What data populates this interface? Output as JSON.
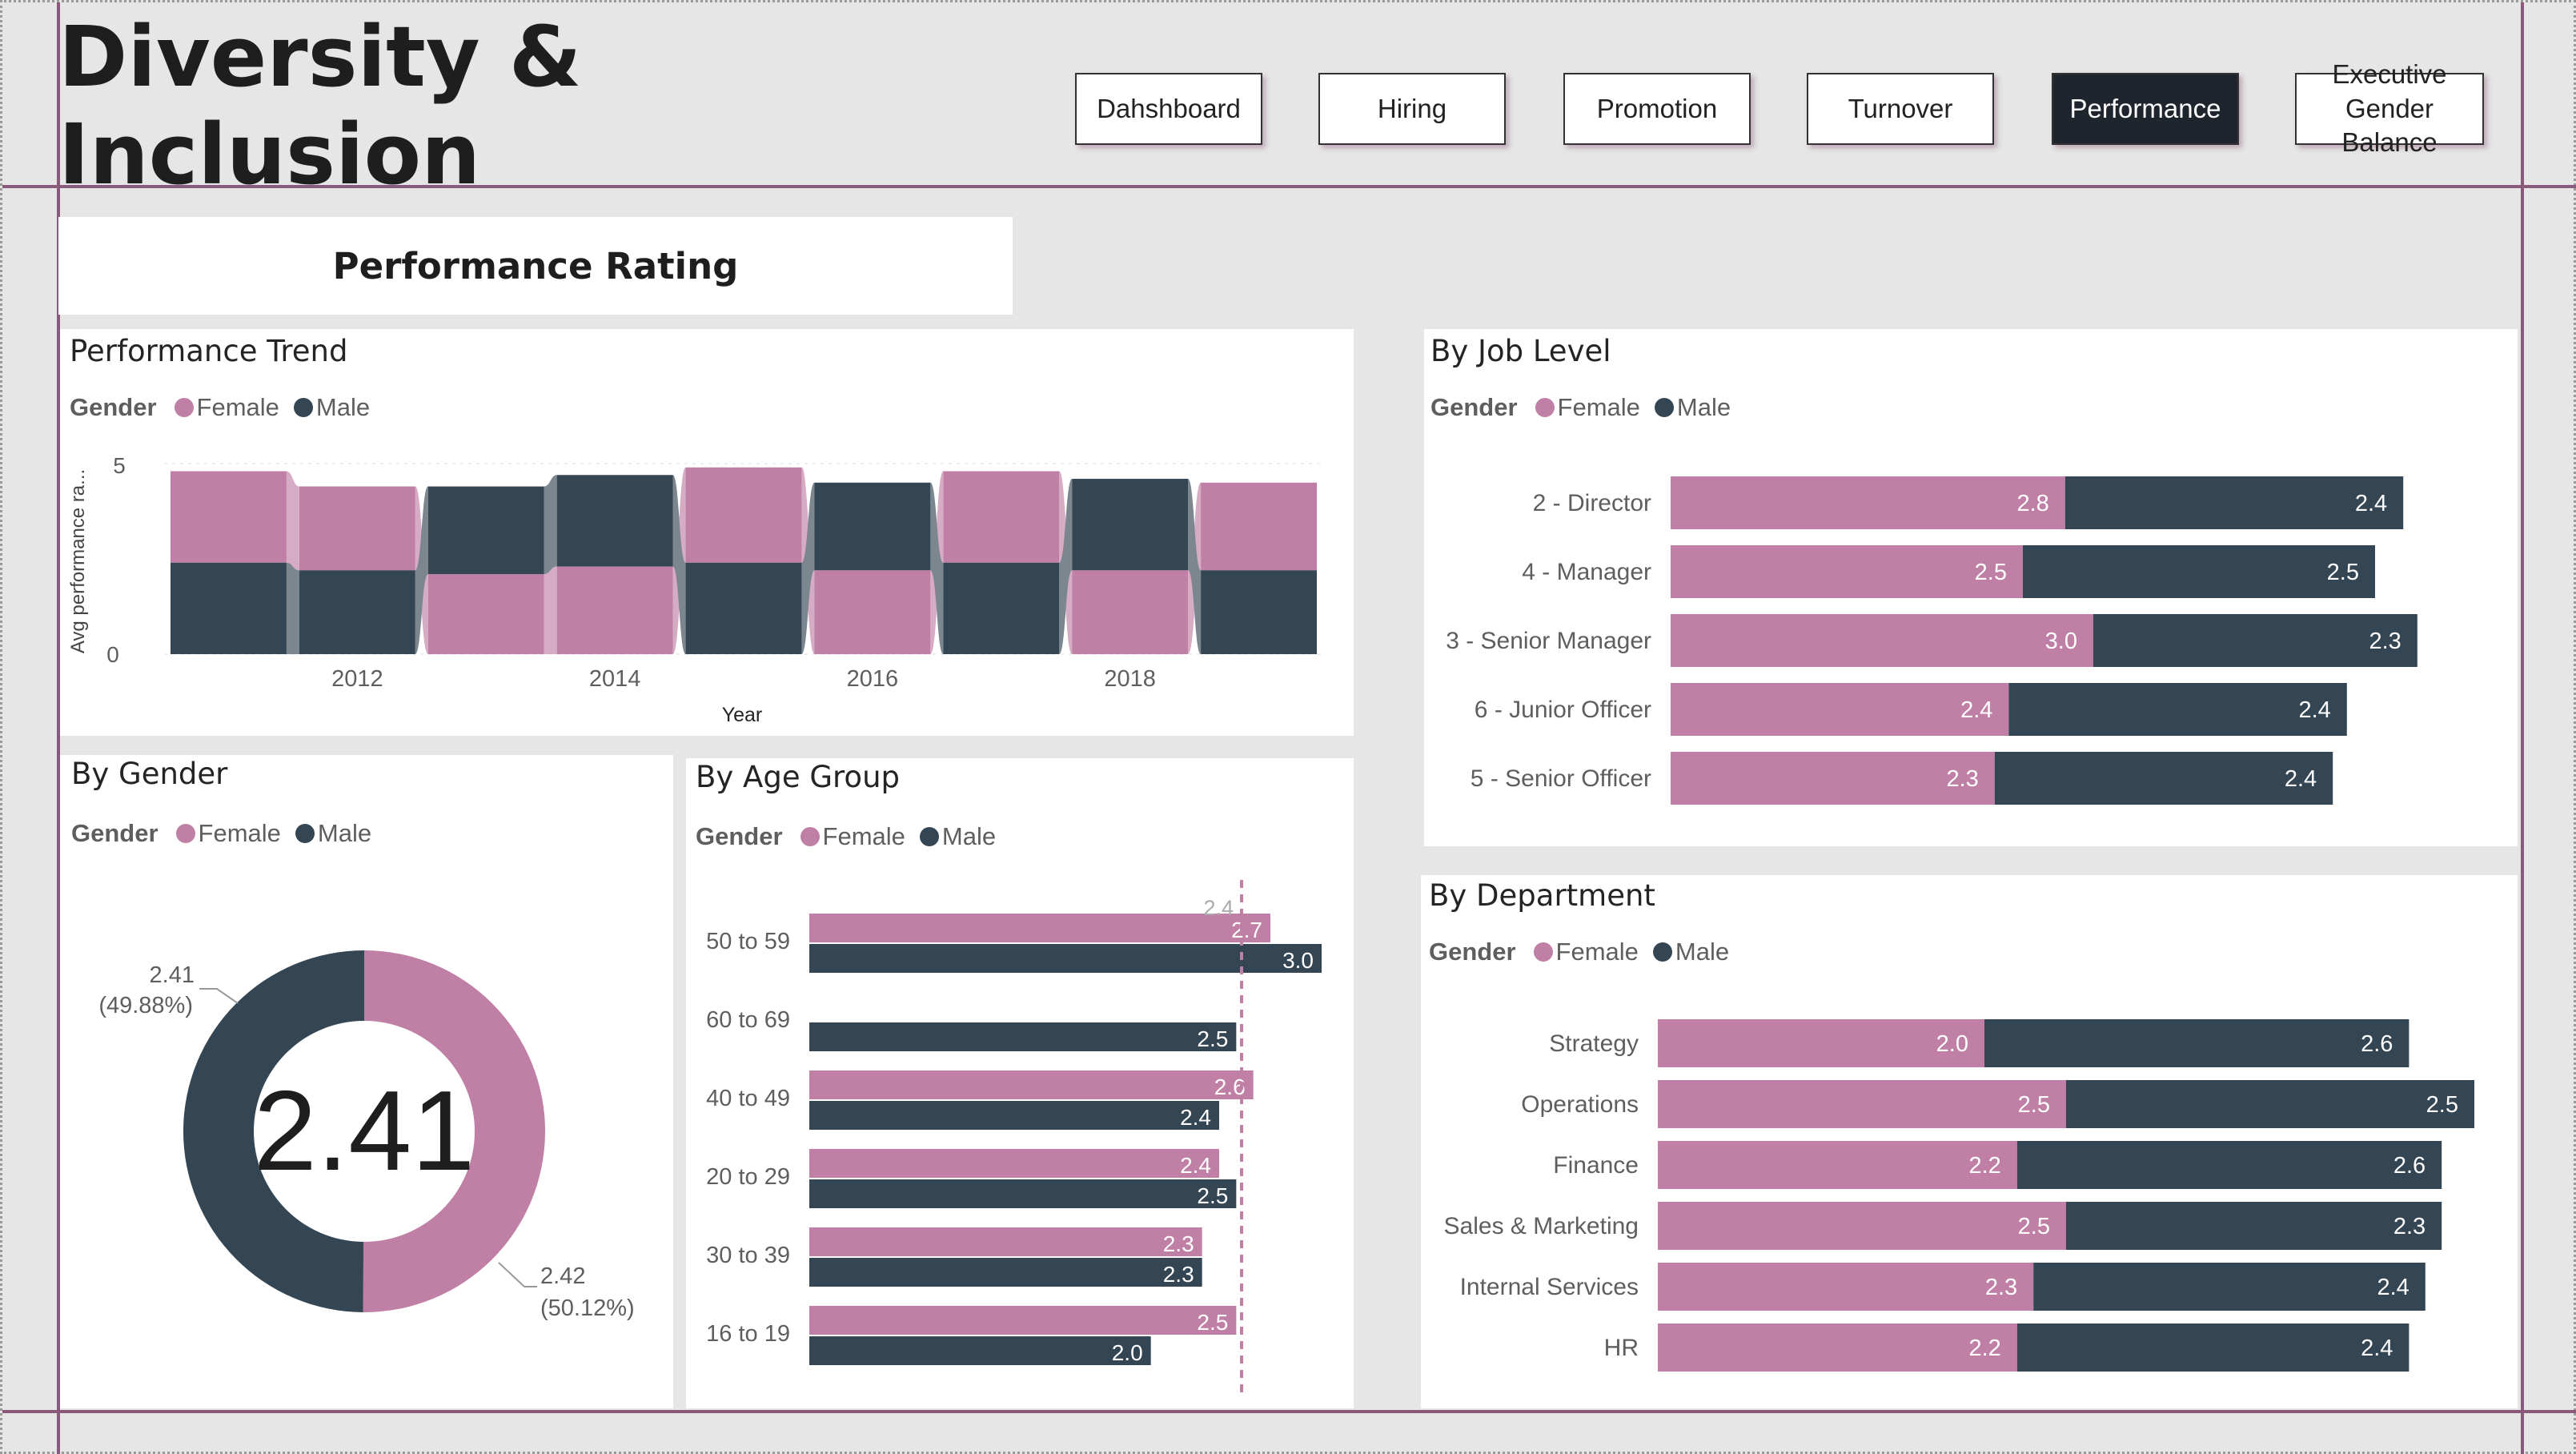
{
  "header": {
    "title": "Diversity & Inclusion"
  },
  "nav": [
    {
      "label": "Dahshboard",
      "active": false
    },
    {
      "label": "Hiring",
      "active": false
    },
    {
      "label": "Promotion",
      "active": false
    },
    {
      "label": "Turnover",
      "active": false
    },
    {
      "label": "Performance",
      "active": true
    },
    {
      "label": "Executive Gender Balance",
      "active": false
    }
  ],
  "section_title": "Performance Rating",
  "colors": {
    "female": "#c07fa5",
    "male": "#344553",
    "accent_line": "#8a5a7a",
    "nav_active": "#1f252c"
  },
  "legend": {
    "title": "Gender",
    "female": "Female",
    "male": "Male"
  },
  "chart_data": [
    {
      "id": "trend",
      "type": "area",
      "title": "Performance Trend",
      "xlabel": "Year",
      "ylabel": "Avg performance ra...",
      "x_ticks": [
        "2012",
        "2014",
        "2016",
        "2018"
      ],
      "y_ticks": [
        "0",
        "5"
      ],
      "ylim": [
        0,
        5
      ],
      "x": [
        2011,
        2012,
        2013,
        2014,
        2015,
        2016,
        2017,
        2018,
        2019
      ],
      "series": [
        {
          "name": "Female",
          "values": [
            2.4,
            2.2,
            2.1,
            2.3,
            2.5,
            2.2,
            2.4,
            2.2,
            2.3
          ]
        },
        {
          "name": "Male",
          "values": [
            2.4,
            2.2,
            2.3,
            2.4,
            2.4,
            2.3,
            2.4,
            2.4,
            2.2
          ]
        }
      ]
    },
    {
      "id": "gender",
      "type": "pie",
      "title": "By Gender",
      "center_label": "2.41",
      "slices": [
        {
          "name": "Female",
          "value": 2.42,
          "label": "2.42",
          "pct": "(50.12%)"
        },
        {
          "name": "Male",
          "value": 2.41,
          "label": "2.41",
          "pct": "(49.88%)"
        }
      ]
    },
    {
      "id": "age",
      "type": "bar",
      "title": "By Age Group",
      "categories": [
        "50 to 59",
        "60 to 69",
        "40 to 49",
        "20 to 29",
        "30 to 39",
        "16 to 19"
      ],
      "series": [
        {
          "name": "Female",
          "values": [
            2.7,
            null,
            2.6,
            2.4,
            2.3,
            2.5
          ]
        },
        {
          "name": "Male",
          "values": [
            3.0,
            2.5,
            2.4,
            2.5,
            2.3,
            2.0
          ]
        }
      ],
      "reference_value": 2.4,
      "reference_label": "2.4",
      "xlim": [
        0,
        3.0
      ]
    },
    {
      "id": "job",
      "type": "bar",
      "title": "By Job Level",
      "stacked": true,
      "categories": [
        "2 - Director",
        "4 - Manager",
        "3 - Senior Manager",
        "6 - Junior Officer",
        "5 - Senior Officer"
      ],
      "series": [
        {
          "name": "Female",
          "values": [
            2.8,
            2.5,
            3.0,
            2.4,
            2.3
          ]
        },
        {
          "name": "Male",
          "values": [
            2.4,
            2.5,
            2.3,
            2.4,
            2.4
          ]
        }
      ]
    },
    {
      "id": "dept",
      "type": "bar",
      "title": "By Department",
      "stacked": true,
      "categories": [
        "Strategy",
        "Operations",
        "Finance",
        "Sales & Marketing",
        "Internal Services",
        "HR"
      ],
      "series": [
        {
          "name": "Female",
          "values": [
            2.0,
            2.5,
            2.2,
            2.5,
            2.3,
            2.2
          ]
        },
        {
          "name": "Male",
          "values": [
            2.6,
            2.5,
            2.6,
            2.3,
            2.4,
            2.4
          ]
        }
      ]
    }
  ]
}
